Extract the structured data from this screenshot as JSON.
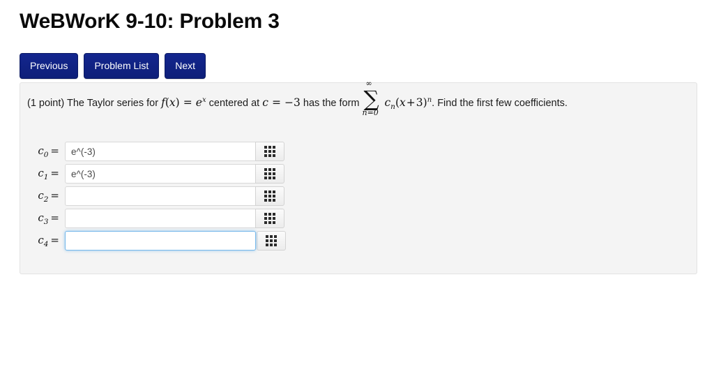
{
  "page": {
    "title": "WeBWorK 9-10: Problem 3"
  },
  "nav": {
    "buttons": [
      {
        "label": "Previous",
        "name": "previous-button"
      },
      {
        "label": "Problem List",
        "name": "problem-list-button"
      },
      {
        "label": "Next",
        "name": "next-button"
      }
    ]
  },
  "problem": {
    "points": "(1 point)",
    "text_1": "The Taylor series for",
    "fn_f": "f",
    "fn_paren_open": "(",
    "fn_var": "x",
    "fn_paren_close": ")",
    "eq_1": "=",
    "base_e": "e",
    "exp_x": "x",
    "text_2": "centered at",
    "var_c": "c",
    "eq_2": "=",
    "value_c": "−3",
    "text_3": "has the form",
    "sum_symbol": "∑",
    "sum_upper": "∞",
    "sum_lower": "n=0",
    "coef_c": "c",
    "coef_sub_n": "n",
    "term_open": "(",
    "term_var": "x",
    "term_plus": "+",
    "term_const": "3",
    "term_close": ")",
    "term_exp": "n",
    "text_4": ". Find the first few coefficients."
  },
  "answers": {
    "keypad_icon": "grid-keypad-icon",
    "rows": [
      {
        "label_base": "c",
        "label_sub": "0",
        "equals": "=",
        "value": "e^(-3)",
        "placeholder": "",
        "focused": false
      },
      {
        "label_base": "c",
        "label_sub": "1",
        "equals": "=",
        "value": "e^(-3)",
        "placeholder": "",
        "focused": false
      },
      {
        "label_base": "c",
        "label_sub": "2",
        "equals": "=",
        "value": "",
        "placeholder": "",
        "focused": false
      },
      {
        "label_base": "c",
        "label_sub": "3",
        "equals": "=",
        "value": "",
        "placeholder": "",
        "focused": false
      },
      {
        "label_base": "c",
        "label_sub": "4",
        "equals": "=",
        "value": "",
        "placeholder": "",
        "focused": true
      }
    ]
  },
  "colors": {
    "button_blue": "#132a8e",
    "panel_bg": "#f4f4f4",
    "panel_border": "#e2e2e2",
    "focus_blue": "#74b7ea",
    "text": "#1b1b1b"
  }
}
